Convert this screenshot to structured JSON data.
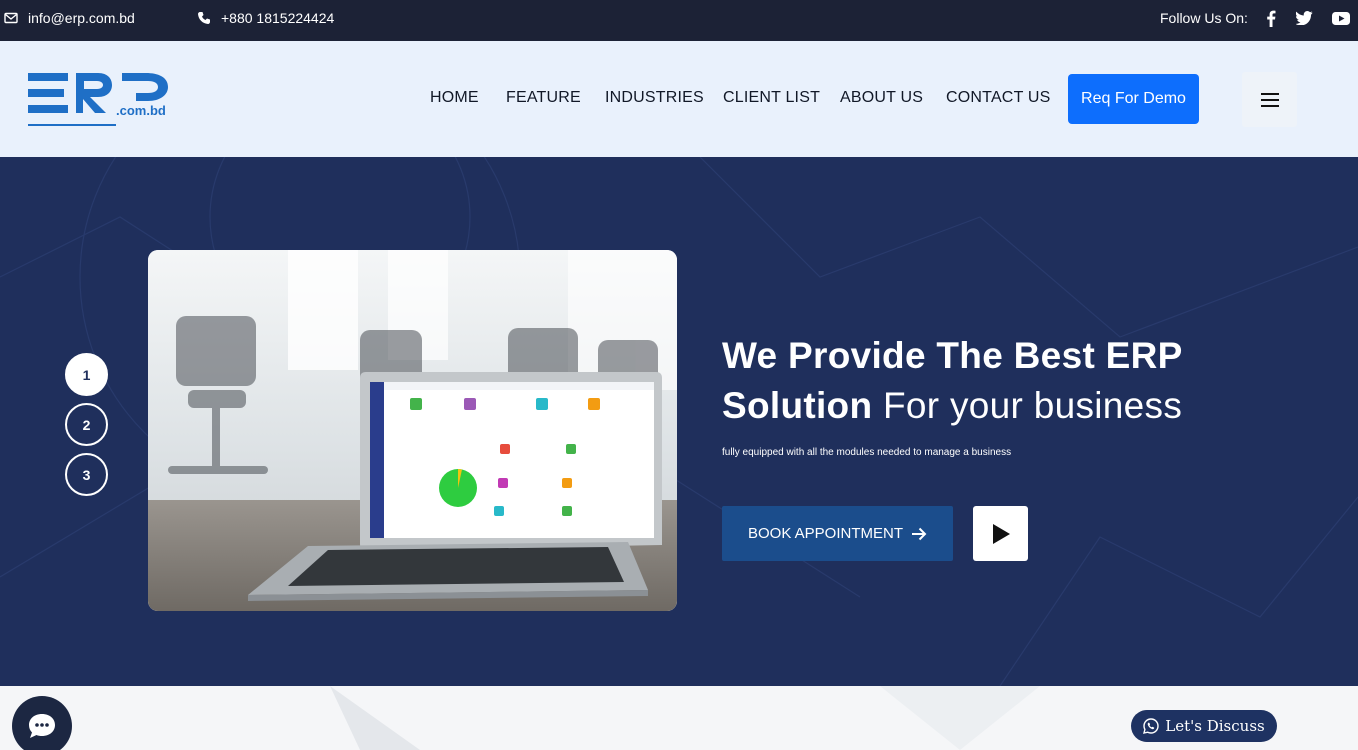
{
  "topbar": {
    "email": "info@erp.com.bd",
    "phone": "+880 1815224424",
    "follow_label": "Follow Us On:",
    "social": [
      "facebook-icon",
      "twitter-icon",
      "youtube-icon"
    ]
  },
  "header": {
    "logo_text": "ERP",
    "logo_domain": ".com.bd",
    "nav": [
      "HOME",
      "FEATURE",
      "INDUSTRIES",
      "CLIENT LIST",
      "ABOUT US",
      "CONTACT US"
    ],
    "demo_button": "Req For Demo"
  },
  "hero": {
    "slides": [
      "1",
      "2",
      "3"
    ],
    "active_slide": 1,
    "headline_bold_1": "We Provide The Best ERP",
    "headline_bold_2": "Solution",
    "headline_light": "For your business",
    "subtitle": "fully equipped with all the modules needed to manage a business",
    "book_button": "BOOK APPOINTMENT"
  },
  "widgets": {
    "discuss_label": "Let's Discuss"
  },
  "colors": {
    "topbar_bg": "#1c2236",
    "header_bg": "#e9f1fc",
    "hero_bg": "#1f2f5c",
    "primary": "#0d6efd",
    "book_btn": "#1b4d8c",
    "logo_blue": "#1f6fc6"
  }
}
